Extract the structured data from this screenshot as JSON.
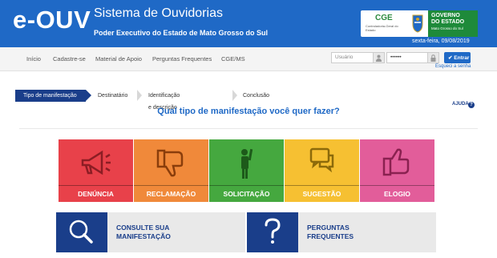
{
  "header": {
    "brand": "e-OUV",
    "title": "Sistema de Ouvidorias",
    "subtitle": "Poder Executivo do Estado de Mato Grosso do Sul",
    "date": "sexta-feira, 09/08/2019",
    "logo": {
      "cge": "CGE",
      "cge_small": "Controladoria-Geral do Estado",
      "gov_line1": "GOVERNO",
      "gov_line2": "DO ESTADO",
      "gov_line3": "Mato Grosso do Sul"
    }
  },
  "nav": {
    "items": [
      "Início",
      "Cadastre-se",
      "Material de Apoio",
      "Perguntas Frequentes",
      "CGE/MS"
    ],
    "login": {
      "user_placeholder": "Usuário",
      "password_value": "••••••",
      "submit_label": "Entrar",
      "forgot_label": "Esqueci a senha"
    }
  },
  "steps": [
    "Tipo de manifestação",
    "Destinatário",
    "Identificação e descrição",
    "Conclusão"
  ],
  "help_label": "AJUDA",
  "question": "Qual tipo de manifestação você quer fazer?",
  "tiles": [
    {
      "label": "DENÚNCIA",
      "icon": "megaphone-icon",
      "color": "#e8414a"
    },
    {
      "label": "RECLAMAÇÃO",
      "icon": "thumbs-down-icon",
      "color": "#f0893a"
    },
    {
      "label": "SOLICITAÇÃO",
      "icon": "person-raising-hand-icon",
      "color": "#45a83f"
    },
    {
      "label": "SUGESTÃO",
      "icon": "chat-bubbles-icon",
      "color": "#f6c032"
    },
    {
      "label": "ELOGIO",
      "icon": "thumbs-up-icon",
      "color": "#e25d9a"
    }
  ],
  "bottom": {
    "consult_line1": "CONSULTE SUA",
    "consult_line2": "MANIFESTAÇÃO",
    "faq_line1": "PERGUNTAS",
    "faq_line2": "FREQUENTES"
  },
  "colors": {
    "header_blue": "#1f69c6",
    "dark_blue": "#1a3e8a",
    "gov_green": "#1e8a3a"
  }
}
